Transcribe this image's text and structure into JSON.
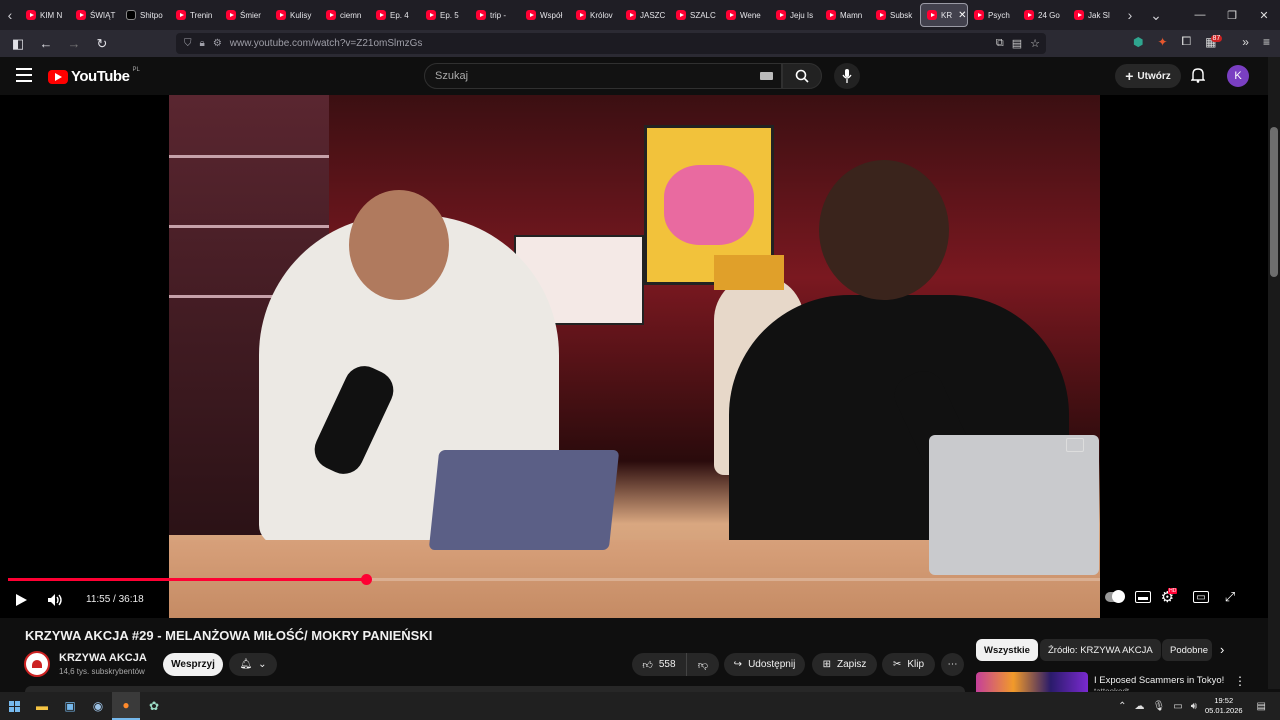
{
  "browser": {
    "tabs": [
      {
        "label": "KIM N",
        "icon": "youtube-icon"
      },
      {
        "label": "ŚWIĄT",
        "icon": "youtube-icon"
      },
      {
        "label": "Shitpo",
        "icon": "x-icon"
      },
      {
        "label": "Trenin",
        "icon": "youtube-icon"
      },
      {
        "label": "Śmier",
        "icon": "youtube-icon"
      },
      {
        "label": "Kulisy",
        "icon": "youtube-icon"
      },
      {
        "label": "ciemn",
        "icon": "youtube-icon"
      },
      {
        "label": "Ep. 4",
        "icon": "youtube-icon"
      },
      {
        "label": "Ep. 5",
        "icon": "youtube-icon"
      },
      {
        "label": "trip -",
        "icon": "youtube-icon"
      },
      {
        "label": "Współ",
        "icon": "youtube-icon"
      },
      {
        "label": "Królov",
        "icon": "youtube-icon"
      },
      {
        "label": "JASZC",
        "icon": "youtube-icon"
      },
      {
        "label": "SZALC",
        "icon": "youtube-icon"
      },
      {
        "label": "Wene",
        "icon": "youtube-icon"
      },
      {
        "label": "Jeju Is",
        "icon": "youtube-icon"
      },
      {
        "label": "Mamn",
        "icon": "youtube-icon"
      },
      {
        "label": "Subsk",
        "icon": "youtube-icon"
      },
      {
        "label": "KR",
        "icon": "youtube-icon",
        "active": true
      },
      {
        "label": "Psych",
        "icon": "youtube-icon"
      },
      {
        "label": "24 Go",
        "icon": "youtube-icon"
      },
      {
        "label": "Jak Sl",
        "icon": "youtube-icon"
      }
    ],
    "url": "www.youtube.com/watch?v=Z21omSlmzGs",
    "extension_badge": "87"
  },
  "youtube": {
    "logo_text": "YouTube",
    "country_code": "PL",
    "search_placeholder": "Szukaj",
    "create_label": "Utwórz",
    "avatar_letter": "K"
  },
  "player": {
    "current_time": "11:55",
    "duration": "36:18",
    "time_display": "11:55 / 36:18",
    "progress_fraction": 0.328,
    "played_color": "#ff0033"
  },
  "video": {
    "title": "KRZYWA AKCJA #29 - MELANŻOWA MIŁOŚĆ/ MOKRY PANIEŃSKI",
    "channel_name": "KRZYWA AKCJA",
    "subscribers": "14,6 tys. subskrybentów",
    "support_label": "Wesprzyj",
    "likes": "558",
    "share_label": "Udostępnij",
    "save_label": "Zapisz",
    "clip_label": "Klip"
  },
  "chips": [
    "Wszystkie",
    "Źródło: KRZYWA AKCJA",
    "Podobne"
  ],
  "recommendation": {
    "title": "I Exposed Scammers in Tokyo!",
    "channel": "tattookodt"
  },
  "taskbar": {
    "time": "19:52",
    "date": "05.01.2026"
  }
}
